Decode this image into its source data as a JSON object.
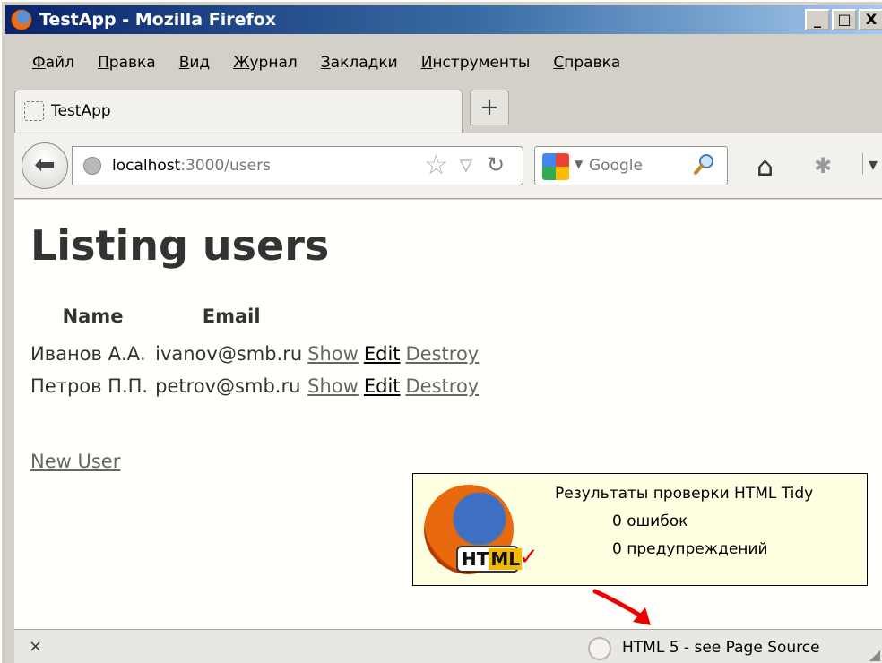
{
  "window": {
    "title": "TestApp - Mozilla Firefox",
    "minimize": "_",
    "maximize": "□",
    "close": "X"
  },
  "menu": [
    "Файл",
    "Правка",
    "Вид",
    "Журнал",
    "Закладки",
    "Инструменты",
    "Справка"
  ],
  "tab": {
    "label": "TestApp",
    "new_tab": "+"
  },
  "nav": {
    "url_host": "localhost",
    "url_path": ":3000/users",
    "search_placeholder": "Google"
  },
  "page": {
    "title": "Listing users",
    "columns": [
      "Name",
      "Email"
    ],
    "users": [
      {
        "name": "Иванов А.А.",
        "email": "ivanov@smb.ru"
      },
      {
        "name": "Петров П.П.",
        "email": "petrov@smb.ru"
      }
    ],
    "actions": {
      "show": "Show",
      "edit": "Edit",
      "destroy": "Destroy"
    },
    "new_user": "New User"
  },
  "tidy": {
    "badge_ht": "HT",
    "badge_ml": "ML",
    "title": "Результаты проверки HTML Tidy",
    "errors": "0 ошибок",
    "warnings": "0 предупреждений"
  },
  "status": {
    "text": "HTML 5 - see Page Source",
    "close": "×"
  }
}
